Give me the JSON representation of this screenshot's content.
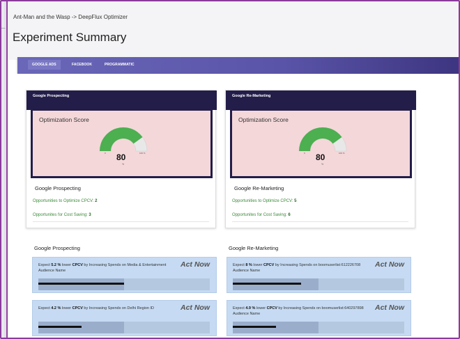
{
  "header": {
    "breadcrumb": "Ant-Man and the Wasp -> DeepFlux Optimizer",
    "title": "Experiment Summary"
  },
  "tabs": [
    {
      "label": "GOOGLE ADS",
      "active": true
    },
    {
      "label": "FACEBOOK",
      "active": false
    },
    {
      "label": "PROGRAMMATIC",
      "active": false
    }
  ],
  "score_cards": [
    {
      "header": "Google Prospecting",
      "score_label": "Optimization Score",
      "score": "80",
      "unit": "%",
      "gauge_min": "0",
      "gauge_max": "100 %",
      "score_fraction": 0.8,
      "title": "Google Prospecting",
      "opp_label": "Opportunities to Optimize CPCV:",
      "opp_value": "2",
      "save_label": "Opportunites for Cost Saving:",
      "save_value": "3"
    },
    {
      "header": "Google Re-Marketing",
      "score_label": "Optimization Score",
      "score": "80",
      "unit": "%",
      "gauge_min": "0",
      "gauge_max": "100 %",
      "score_fraction": 0.8,
      "title": "Google Re-Marketing",
      "opp_label": "Opportunities to Optimize CPCV:",
      "opp_value": "5",
      "save_label": "Opportunites for Cost Saving:",
      "save_value": "6"
    }
  ],
  "sections": [
    {
      "title": "Google Prospecting",
      "recs": [
        {
          "pre": "Expect ",
          "pct": "5.2 %",
          "mid": " lower ",
          "metric": "CPCV",
          "post": " by Increasing Spends on Media & Entertainment Audience Name",
          "action": "Act Now",
          "progress_fill": 0.5,
          "progress_shade": 0.5
        },
        {
          "pre": "Expect ",
          "pct": "4.2 %",
          "mid": " lower ",
          "metric": "CPCV",
          "post": " by Increasing Spends on Delhi Region ID",
          "action": "Act Now",
          "progress_fill": 0.25,
          "progress_shade": 0.5
        }
      ]
    },
    {
      "title": "Google Re-Marketing",
      "recs": [
        {
          "pre": "Expect ",
          "pct": "8 %",
          "mid": " lower ",
          "metric": "CPCV",
          "post": " by Increasing Spends on boomuserlist:612226708 Audience Name",
          "action": "Act Now",
          "progress_fill": 0.4,
          "progress_shade": 0.5
        },
        {
          "pre": "Expect ",
          "pct": "4.9 %",
          "mid": " lower ",
          "metric": "CPCV",
          "post": " by Increasing Spends on boomuserlist:640297898 Audience Name",
          "action": "Act Now",
          "progress_fill": 0.25,
          "progress_shade": 0.5
        }
      ]
    }
  ],
  "colors": {
    "card_header": "#231d4a",
    "score_bg": "#f4d7d9",
    "gauge_fill": "#4caf50",
    "gauge_track": "#e8e8e8",
    "opportunity_text": "#3a8a3a",
    "rec_bg": "#c6dbf3",
    "tab_gradient_start": "#6a67b8",
    "tab_gradient_end": "#3d3580"
  }
}
